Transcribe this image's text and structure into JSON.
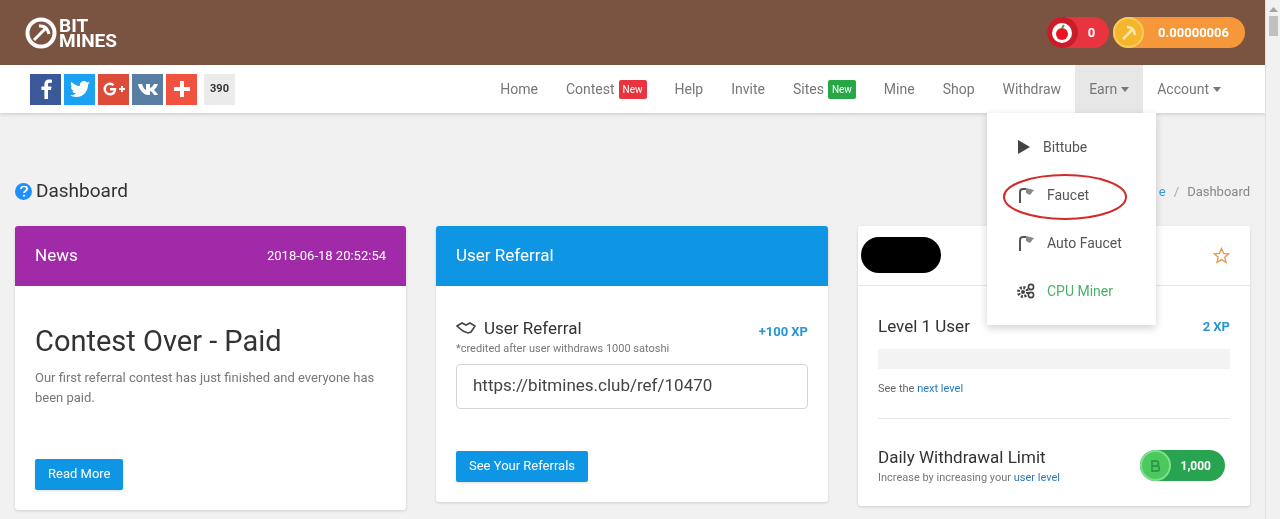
{
  "header": {
    "logo_top": "BIT",
    "logo_bottom": "MINES",
    "apples": "0",
    "balance": "0.00000006"
  },
  "share": {
    "count": "390"
  },
  "nav": [
    {
      "label": "Home",
      "selected": false
    },
    {
      "label": "Contest",
      "selected": false,
      "badge": "New",
      "color": "#e8343f"
    },
    {
      "label": "Help",
      "selected": false
    },
    {
      "label": "Invite",
      "selected": false
    },
    {
      "label": "Sites",
      "selected": false,
      "badge": "New",
      "color": "#28a745"
    },
    {
      "label": "Mine",
      "selected": false
    },
    {
      "label": "Shop",
      "selected": false
    },
    {
      "label": "Withdraw",
      "selected": false
    },
    {
      "label": "Earn",
      "selected": true,
      "caret": true
    },
    {
      "label": "Account",
      "selected": false,
      "caret": true
    }
  ],
  "earn_menu": [
    {
      "label": "Bittube",
      "kind": "play",
      "color": "#555555"
    },
    {
      "label": "Faucet",
      "kind": "faucet",
      "color": "#555555",
      "circled": true
    },
    {
      "label": "Auto Faucet",
      "kind": "faucet",
      "color": "#555555",
      "circled": false
    },
    {
      "label": "CPU Miner",
      "kind": "gears",
      "color": "#4caf6a"
    }
  ],
  "page_title": "Dashboard",
  "breadcrumb_separator": "/",
  "breadcrumb": [
    {
      "label": "e",
      "link": true
    },
    {
      "label": "Dashboard",
      "link": false
    }
  ],
  "news": {
    "title": "News",
    "date": "2018-06-18 20:52:54",
    "headline": "Contest Over - Paid",
    "text": "Our first referral contest has just finished and everyone has been paid.",
    "button": "Read More"
  },
  "referral": {
    "title": "User Referral",
    "subtitle": "User Referral",
    "note": "*credited after user withdraws 1000 satoshi",
    "xp": "+100 XP",
    "link": "https://bitmines.club/ref/10470",
    "button": "See Your Referrals"
  },
  "user": {
    "level_title": "Level 1 User",
    "xp": "2 XP",
    "level": 0,
    "next_prefix": "See the",
    "next_link": "next level",
    "limit_title": "Daily Withdrawal Limit",
    "limit_prefix": "Increase by increasing your",
    "limit_link": "user level",
    "limit_value": "1,000"
  }
}
